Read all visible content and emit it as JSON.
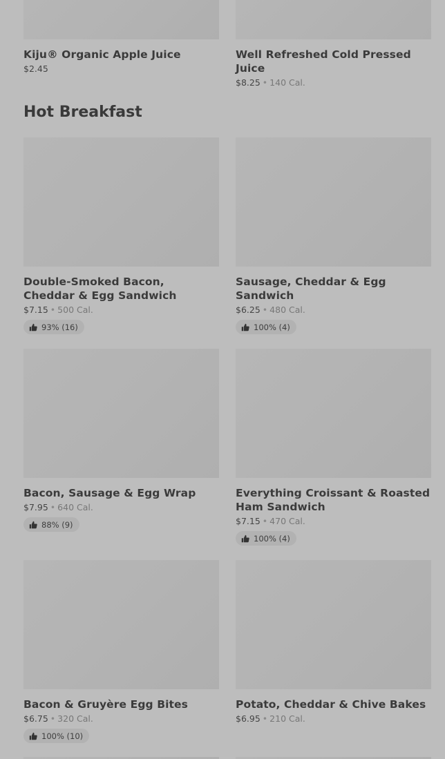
{
  "section": {
    "title": "Hot Breakfast"
  },
  "top_items": [
    {
      "name": "Kiju® Organic Apple Juice",
      "price": "$2.45",
      "calories": ""
    },
    {
      "name": "Well Refreshed Cold Pressed Juice",
      "price": "$8.25",
      "calories": "140 Cal."
    }
  ],
  "items": [
    {
      "name": "Double-Smoked Bacon, Cheddar & Egg Sandwich",
      "price": "$7.15",
      "calories": "500 Cal.",
      "rating": "93% (16)"
    },
    {
      "name": "Sausage, Cheddar & Egg Sandwich",
      "price": "$6.25",
      "calories": "480 Cal.",
      "rating": "100% (4)"
    },
    {
      "name": "Bacon, Sausage & Egg Wrap",
      "price": "$7.95",
      "calories": "640 Cal.",
      "rating": "88% (9)"
    },
    {
      "name": "Everything Croissant & Roasted Ham Sandwich",
      "price": "$7.15",
      "calories": "470 Cal.",
      "rating": "100% (4)"
    },
    {
      "name": "Bacon & Gruyère Egg Bites",
      "price": "$6.75",
      "calories": "320 Cal.",
      "rating": "100% (10)"
    },
    {
      "name": "Potato, Cheddar & Chive Bakes",
      "price": "$6.95",
      "calories": "210 Cal.",
      "rating": ""
    }
  ],
  "icons": {
    "rating": "thumbs-up-icon",
    "separator": "•"
  }
}
